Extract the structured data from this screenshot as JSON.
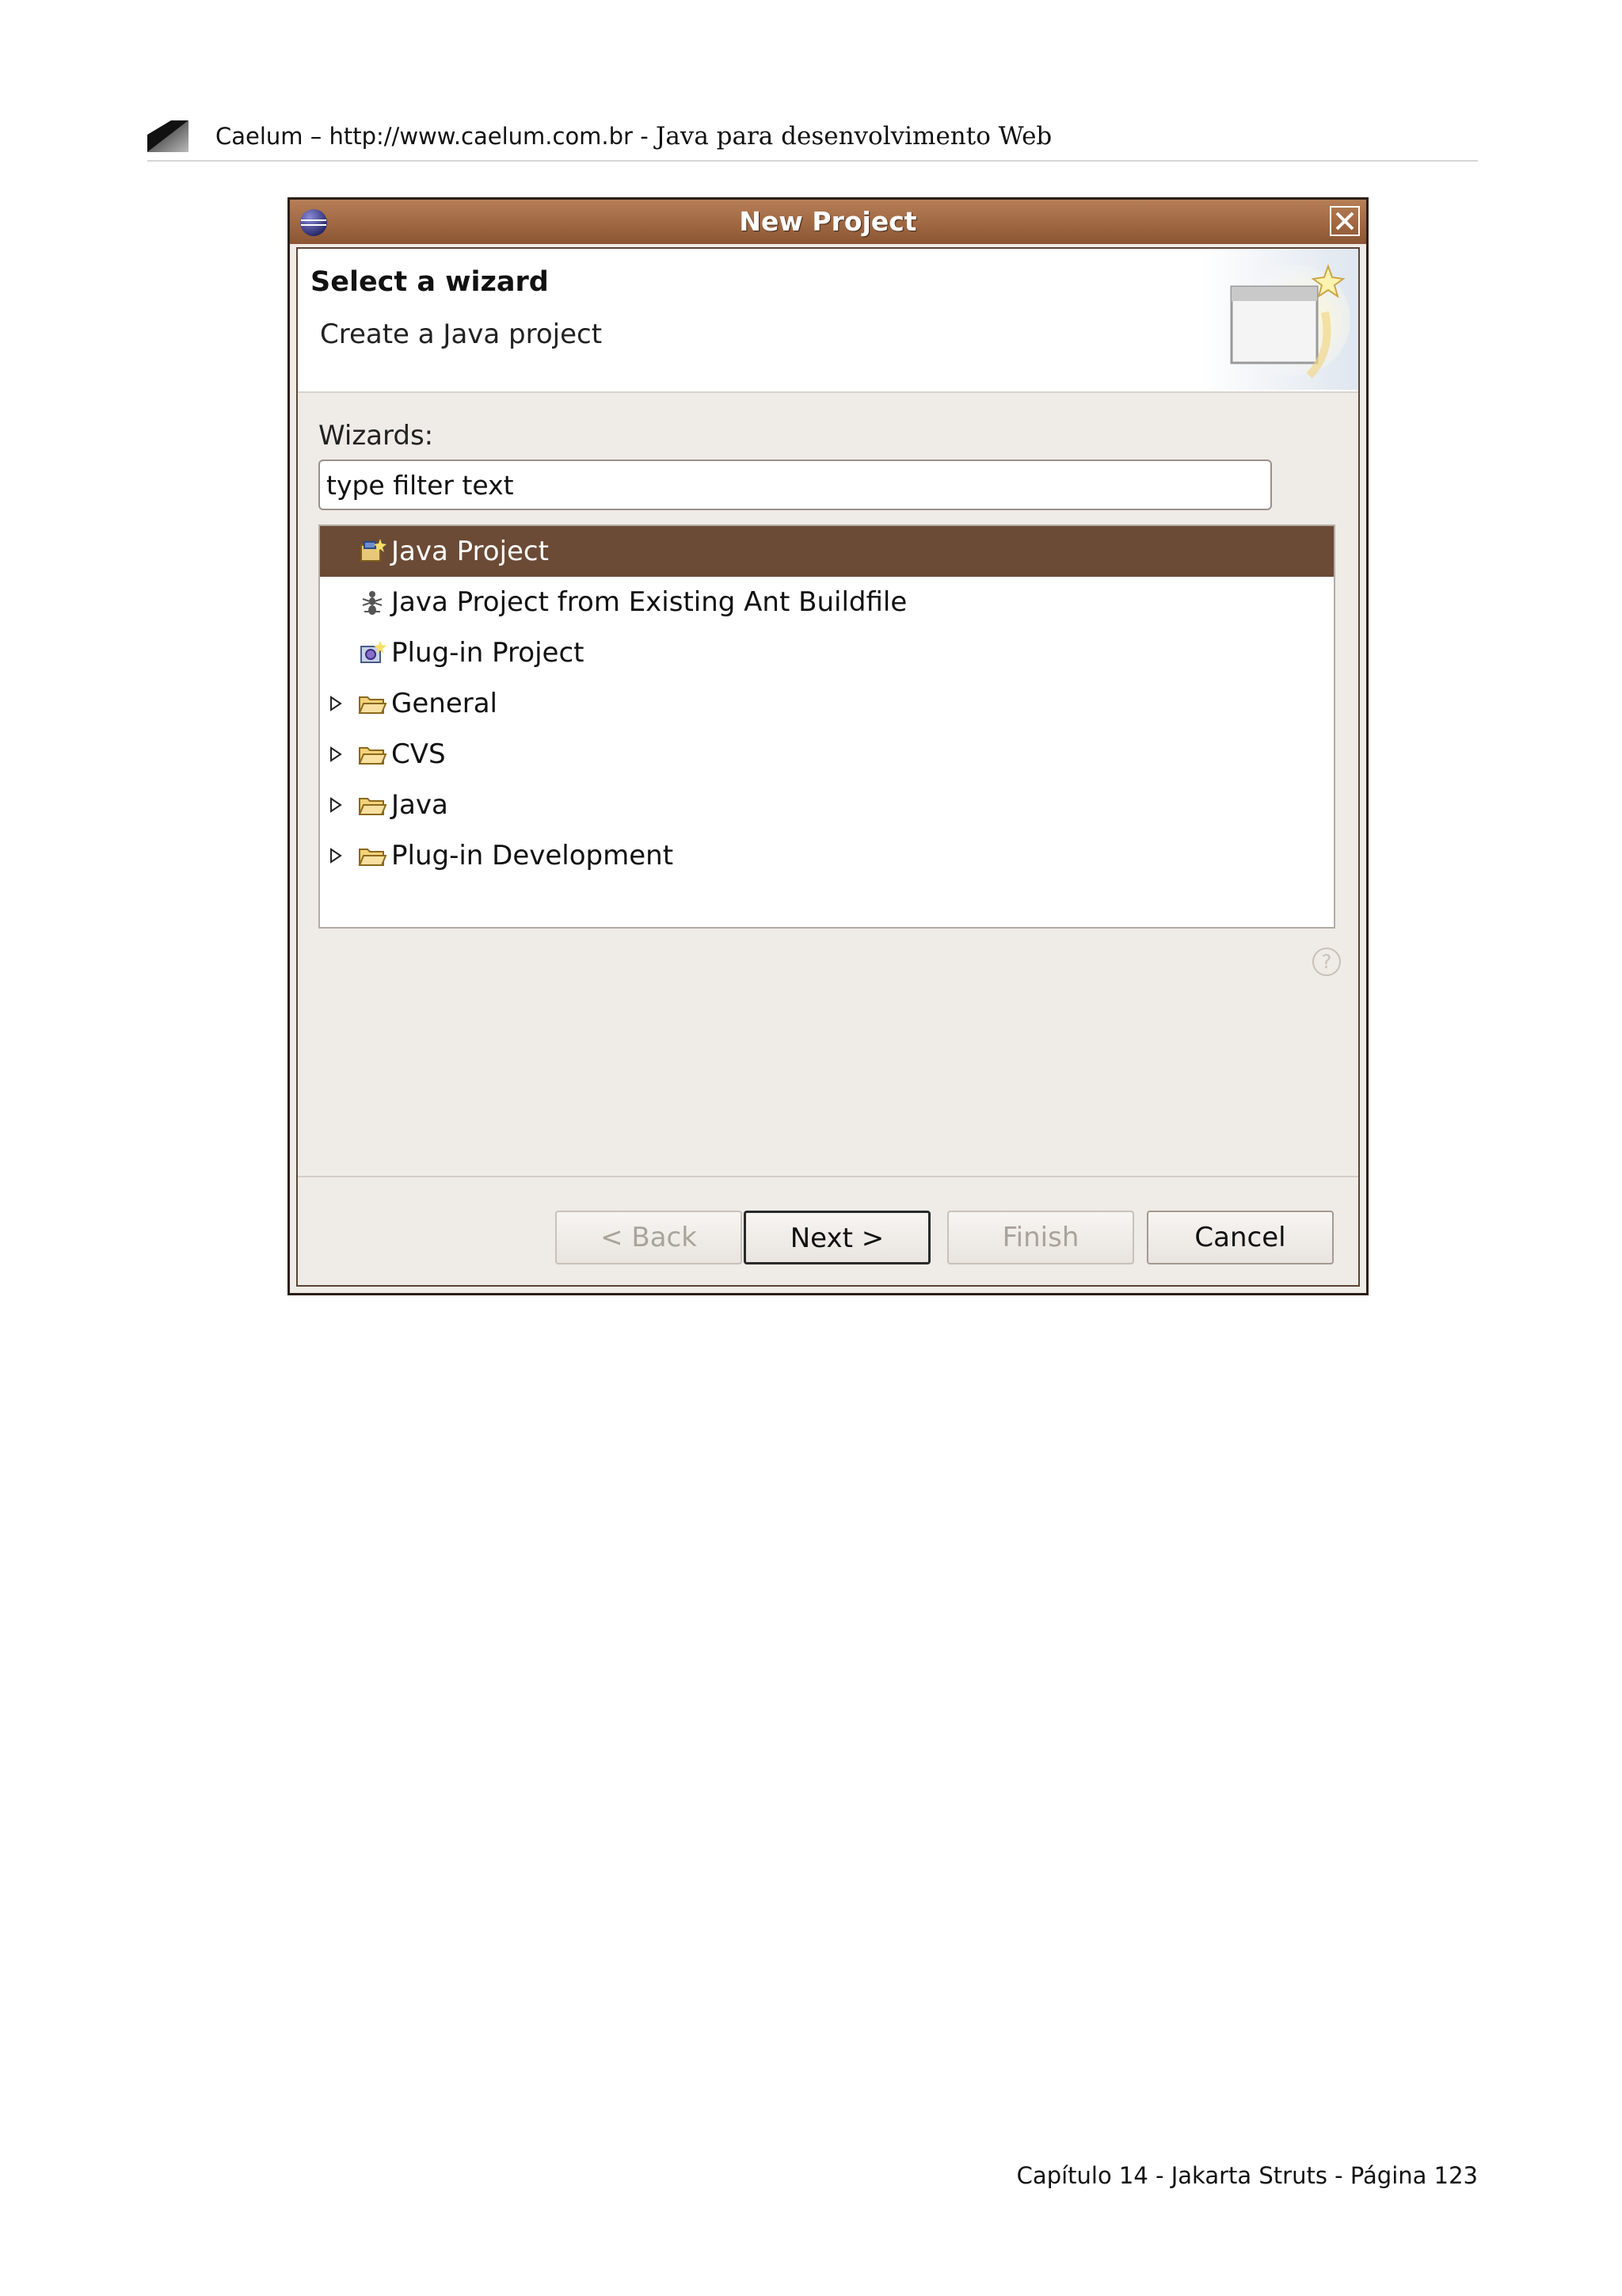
{
  "page_header": {
    "site": "Caelum – http://www.caelum.com.br - ",
    "subtitle": "Java para desenvolvimento Web"
  },
  "dialog": {
    "title": "New Project",
    "banner": {
      "title": "Select a wizard",
      "description": "Create a Java project"
    },
    "wizards_label": "Wizards:",
    "filter_placeholder": "type filter text",
    "tree": {
      "items": [
        {
          "label": "Java Project",
          "icon": "java-project-icon",
          "selected": true,
          "expandable": false
        },
        {
          "label": "Java Project from Existing Ant Buildfile",
          "icon": "ant-icon",
          "selected": false,
          "expandable": false
        },
        {
          "label": "Plug-in Project",
          "icon": "plugin-project-icon",
          "selected": false,
          "expandable": false
        },
        {
          "label": "General",
          "icon": "folder-icon",
          "selected": false,
          "expandable": true
        },
        {
          "label": "CVS",
          "icon": "folder-icon",
          "selected": false,
          "expandable": true
        },
        {
          "label": "Java",
          "icon": "folder-icon",
          "selected": false,
          "expandable": true
        },
        {
          "label": "Plug-in Development",
          "icon": "folder-icon",
          "selected": false,
          "expandable": true
        }
      ]
    },
    "buttons": {
      "back": "< Back",
      "next": "Next >",
      "finish": "Finish",
      "cancel": "Cancel"
    }
  },
  "page_footer": "Capítulo 14 - Jakarta Struts - Página 123",
  "colors": {
    "titlebar": "#a06a43",
    "selection": "#6b4a36",
    "dialog_bg": "#efebe7"
  }
}
